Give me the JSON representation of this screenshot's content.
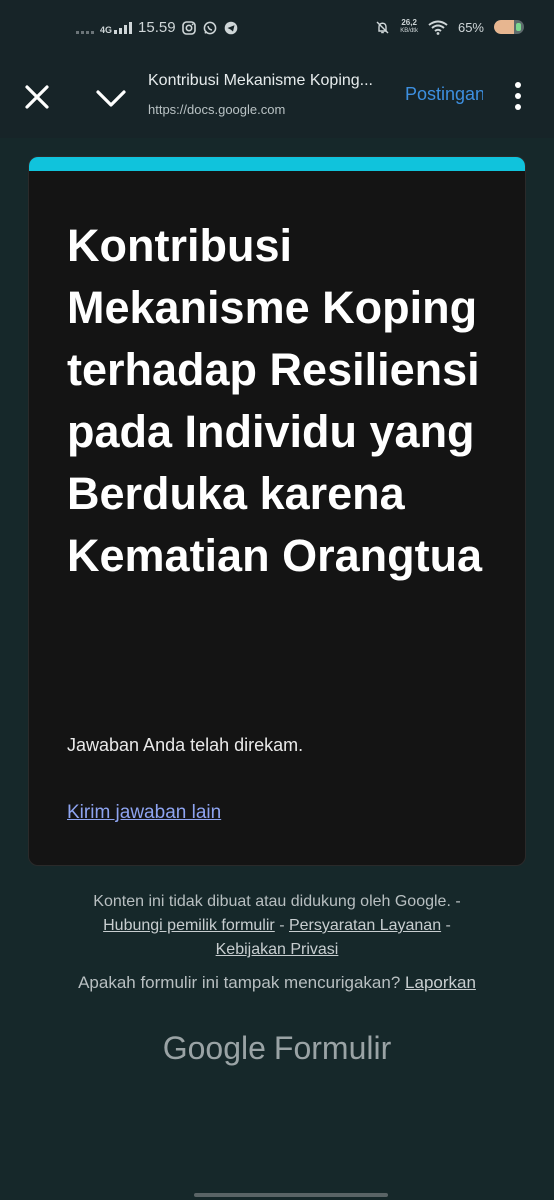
{
  "status_bar": {
    "net_label": "4G",
    "time": "15.59",
    "speed_value": "26,2",
    "speed_unit": "KB/dtk",
    "battery_percent": "65%",
    "battery_level": 0.65
  },
  "toolbar": {
    "title": "Kontribusi Mekanisme Koping...",
    "url": "https://docs.google.com",
    "post_label": "Postingan"
  },
  "form": {
    "accent_color": "#10c3dc",
    "title": "Kontribusi Mekanisme Koping terhadap Resiliensi pada Individu yang Berduka karena Kematian Orangtua",
    "confirmation": "Jawaban Anda telah direkam.",
    "resubmit_link": "Kirim jawaban lain"
  },
  "footer": {
    "disclaimer": "Konten ini tidak dibuat atau didukung oleh Google.",
    "sep": "-",
    "contact_link": "Hubungi pemilik formulir",
    "terms_link": "Persyaratan Layanan",
    "privacy_link": "Kebijakan Privasi",
    "report_question": "Apakah formulir ini tampak mencurigakan?",
    "report_link": "Laporkan",
    "brand_google": "Google",
    "brand_product": "Formulir"
  }
}
